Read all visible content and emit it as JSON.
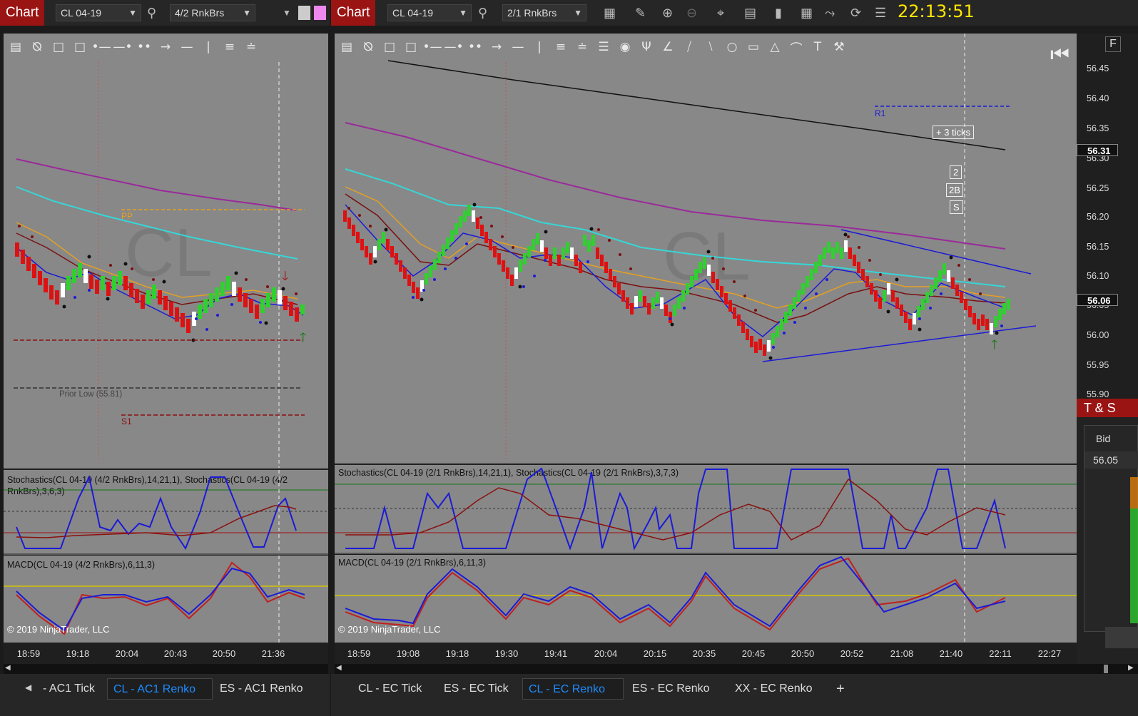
{
  "left_window": {
    "title": "Chart",
    "instrument": "CL 04-19",
    "bar_type": "4/2 RnkBrs",
    "chart_labels": {
      "pp": "PP",
      "prior_low": "Prior Low (55.81)",
      "s1": "S1",
      "watermark": "CL"
    },
    "stochastics_label": "Stochastics(CL 04-19 (4/2 RnkBrs),14,21,1), Stochastics(CL 04-19 (4/2 RnkBrs),3,6,3)",
    "macd_label": "MACD(CL 04-19 (4/2 RnkBrs),6,11,3)",
    "copyright": "© 2019 NinjaTrader, LLC",
    "time_axis": [
      "18:59",
      "19:18",
      "20:04",
      "20:43",
      "20:50",
      "21:36"
    ],
    "tabs": [
      "- AC1 Tick",
      "CL - AC1 Renko",
      "ES - AC1 Renko"
    ],
    "active_tab": 1
  },
  "right_window": {
    "title": "Chart",
    "instrument": "CL 04-19",
    "bar_type": "2/1 RnkBrs",
    "clock": "22:13:51",
    "chart_labels": {
      "r1": "R1",
      "ticks_box": "+ 3 ticks",
      "box_2": "2",
      "box_2b": "2B",
      "box_s": "S",
      "watermark": "CL",
      "f_button": "F"
    },
    "price_axis": [
      "56.45",
      "56.40",
      "56.35",
      "56.30",
      "56.25",
      "56.20",
      "56.15",
      "56.10",
      "56.05",
      "56.00",
      "55.95",
      "55.90"
    ],
    "last_price": "56.31",
    "current_price": "56.06",
    "stochastics_label": "Stochastics(CL 04-19 (2/1 RnkBrs),14,21,1), Stochastics(CL 04-19 (2/1 RnkBrs),3,7,3)",
    "macd_label": "MACD(CL 04-19 (2/1 RnkBrs),6,11,3)",
    "copyright": "© 2019 NinjaTrader, LLC",
    "time_axis": [
      "18:59",
      "19:08",
      "19:18",
      "19:30",
      "19:41",
      "20:04",
      "20:15",
      "20:35",
      "20:45",
      "20:50",
      "20:52",
      "21:08",
      "21:40",
      "22:11",
      "22:27"
    ],
    "tabs": [
      "CL - EC Tick",
      "ES - EC Tick",
      "CL - EC Renko",
      "ES - EC Renko",
      "XX - EC Renko"
    ],
    "active_tab": 2,
    "add_tab": "+"
  },
  "time_and_sales": {
    "title": "T & S",
    "bid_header": "Bid",
    "bid_value": "56.05"
  },
  "colors": {
    "chart_bg": "#888888",
    "up_bar": "#2fd02f",
    "down_bar": "#dd1111",
    "ema_cyan": "#37d6d6",
    "ema_purple": "#9a2a9a",
    "ema_orange": "#e5a020",
    "trend_blue": "#1b1bd8",
    "clock": "#ffe600"
  }
}
